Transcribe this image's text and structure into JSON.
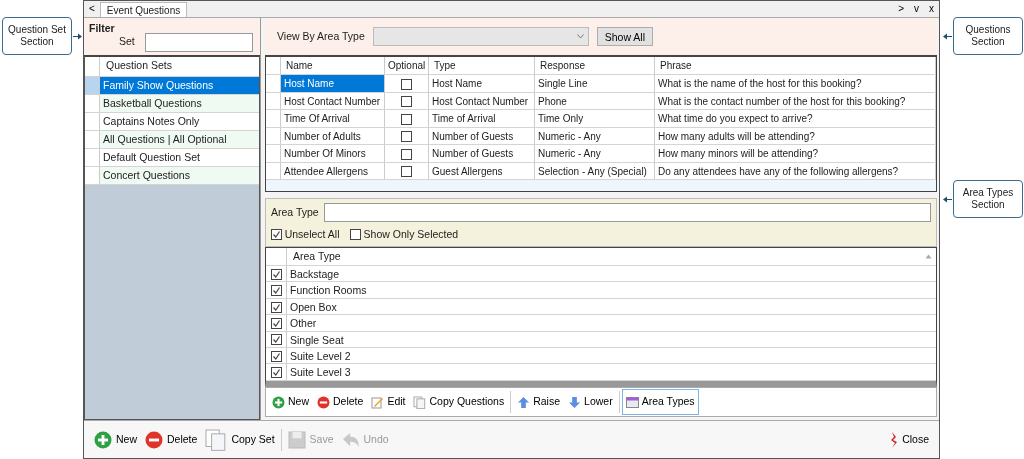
{
  "callouts": [
    {
      "text": "Question Set Section"
    },
    {
      "text": "Questions Section"
    },
    {
      "text": "Area Types Section"
    }
  ],
  "nav_button": "<",
  "tabs": [
    {
      "label": "Event Questions",
      "selected": true
    }
  ],
  "window_controls": [
    ">",
    "v",
    "x"
  ],
  "filter": {
    "title": "Filter",
    "set_label": "Set"
  },
  "question_sets": {
    "header": "Question Sets",
    "items": [
      {
        "label": "Family Show Questions",
        "selected": true
      },
      {
        "label": "Basketball Questions",
        "selected": false
      },
      {
        "label": "Captains Notes Only",
        "selected": false
      },
      {
        "label": "All Questions | All Optional",
        "selected": false
      },
      {
        "label": "Default Question Set",
        "selected": false
      },
      {
        "label": "Concert Questions",
        "selected": false
      }
    ]
  },
  "view_by": {
    "label": "View By Area Type",
    "button": "Show All"
  },
  "questions": {
    "columns": [
      "Name",
      "Optional",
      "Type",
      "Response",
      "Phrase"
    ],
    "rows": [
      {
        "name": "Host Name",
        "optional": false,
        "type": "Host Name",
        "response": "Single Line",
        "phrase": "What is the name of the host for this booking?",
        "selected": true
      },
      {
        "name": "Host Contact Number",
        "optional": false,
        "type": "Host Contact Number",
        "response": "Phone",
        "phrase": "What is the contact number of the host for this booking?",
        "selected": false
      },
      {
        "name": "Time Of Arrival",
        "optional": false,
        "type": "Time of Arrival",
        "response": "Time Only",
        "phrase": "What time do you expect to arrive?",
        "selected": false
      },
      {
        "name": "Number of Adults",
        "optional": false,
        "type": "Number of Guests",
        "response": "Numeric - Any",
        "phrase": "How many adults will be attending?",
        "selected": false
      },
      {
        "name": "Number Of Minors",
        "optional": false,
        "type": "Number of Guests",
        "response": "Numeric - Any",
        "phrase": "How many minors will be attending?",
        "selected": false
      },
      {
        "name": "Attendee Allergens",
        "optional": false,
        "type": "Guest Allergens",
        "response": "Selection - Any (Special)",
        "phrase": "Do any attendees have any of the following allergens?",
        "selected": false
      }
    ]
  },
  "area_filter": {
    "label": "Area Type",
    "checkboxes": [
      {
        "label": "Unselect All",
        "checked": true
      },
      {
        "label": "Show Only Selected",
        "checked": false
      }
    ]
  },
  "area_types": {
    "header": "Area Type",
    "rows": [
      {
        "label": "Backstage",
        "checked": true
      },
      {
        "label": "Function Rooms",
        "checked": true
      },
      {
        "label": "Open Box",
        "checked": true
      },
      {
        "label": "Other",
        "checked": true
      },
      {
        "label": "Single Seat",
        "checked": true
      },
      {
        "label": "Suite Level 2",
        "checked": true
      },
      {
        "label": "Suite Level 3",
        "checked": true
      }
    ]
  },
  "question_toolbar": [
    {
      "label": "New",
      "kind": "add",
      "selected": false
    },
    {
      "label": "Delete",
      "kind": "remove",
      "selected": false
    },
    {
      "label": "Edit",
      "kind": "edit",
      "selected": false
    },
    {
      "label": "Copy Questions",
      "kind": "copy",
      "selected": false
    },
    {
      "label": "Raise",
      "kind": "up",
      "selected": false,
      "separator": true
    },
    {
      "label": "Lower",
      "kind": "down",
      "selected": false
    },
    {
      "label": "Area Types",
      "kind": "window",
      "selected": true,
      "separator": true
    }
  ],
  "bottom_toolbar": [
    {
      "label": "New",
      "kind": "add",
      "disabled": false
    },
    {
      "label": "Delete",
      "kind": "remove",
      "disabled": false
    },
    {
      "label": "Copy Set",
      "kind": "copy",
      "disabled": false
    },
    {
      "label": "Save",
      "kind": "save",
      "disabled": true,
      "separator": true
    },
    {
      "label": "Undo",
      "kind": "undo",
      "disabled": true
    }
  ],
  "close_button": "Close"
}
